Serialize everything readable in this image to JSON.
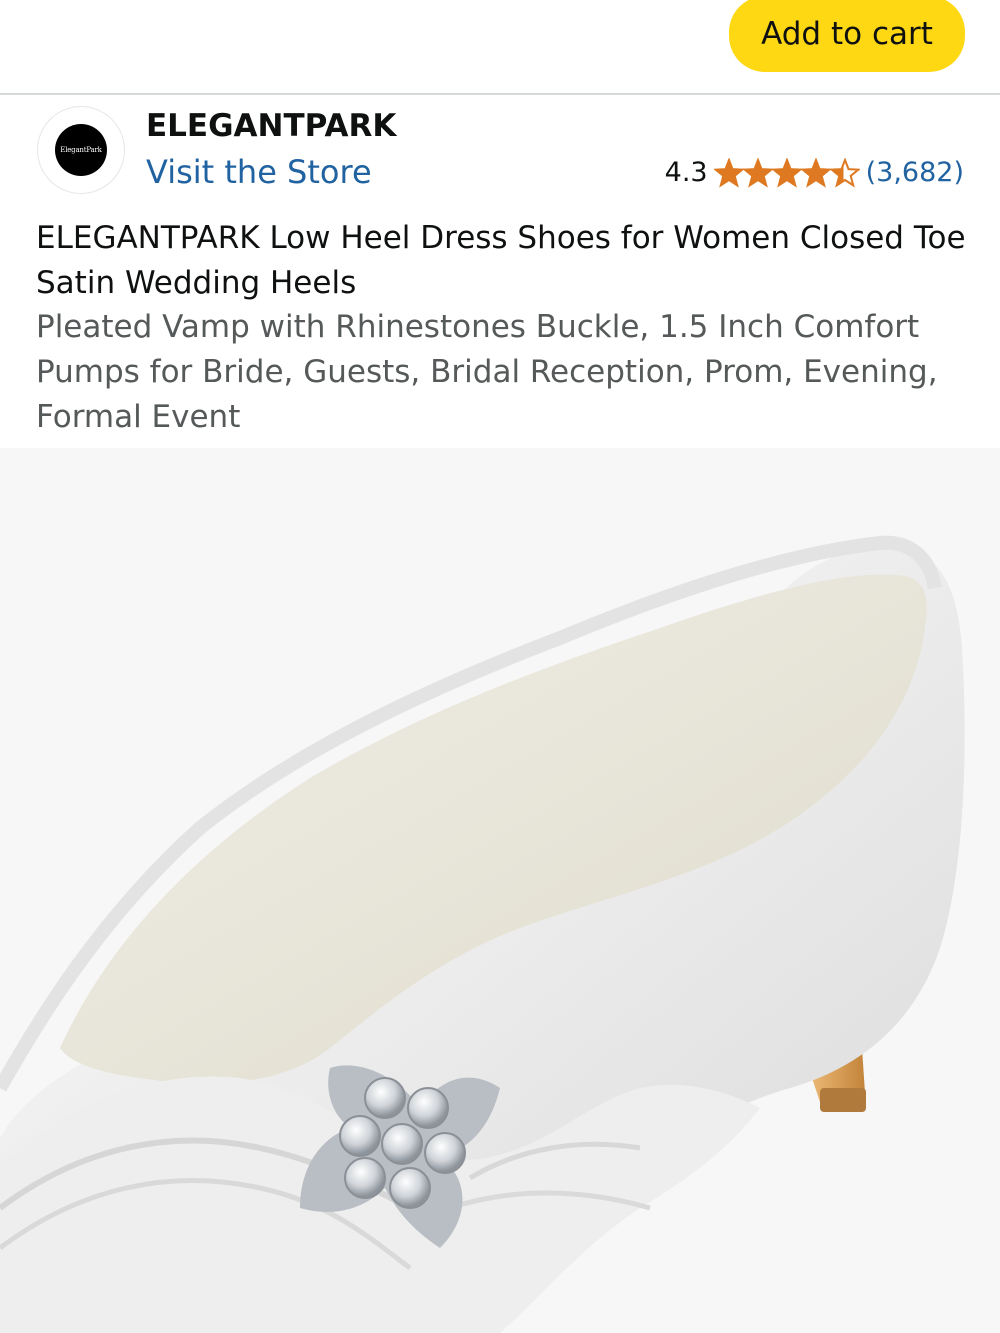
{
  "header": {
    "add_to_cart_label": "Add to cart",
    "button_color": "#ffd814"
  },
  "brand": {
    "logo_text": "ElegantPark",
    "name": "ELEGANTPARK",
    "visit_store": "Visit the Store"
  },
  "rating": {
    "value": "4.3",
    "stars": 4.3,
    "count": "(3,682)",
    "star_color": "#de7921"
  },
  "product": {
    "title": "ELEGANTPARK Low Heel Dress Shoes for Women Closed Toe Satin Wedding Heels",
    "subtitle": "Pleated Vamp with Rhinestones Buckle, 1.5 Inch Comfort Pumps for Bride, Guests, Bridal Reception, Prom, Evening, Formal Event"
  },
  "colors": {
    "link": "#2162a1",
    "secondary_text": "#565959",
    "image_background": "#f7f7f7"
  }
}
